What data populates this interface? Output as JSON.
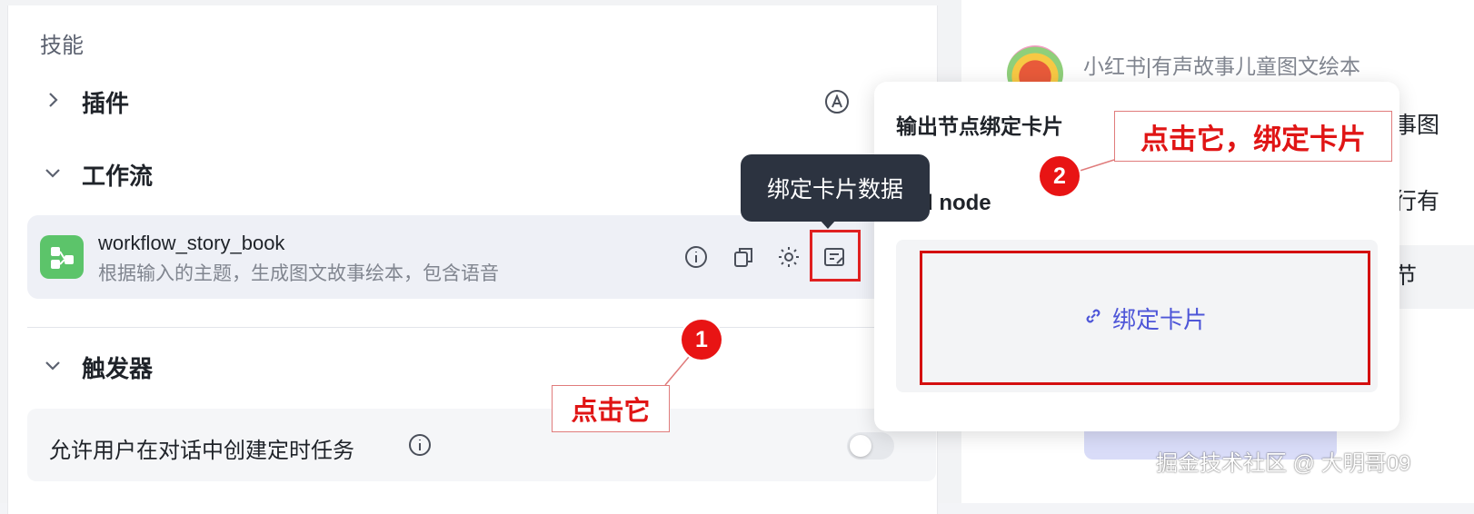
{
  "skills_panel": {
    "section_title": "技能",
    "plugins_label": "插件",
    "workflow_label": "工作流",
    "triggers_label": "触发器",
    "workflow_item": {
      "name": "workflow_story_book",
      "description": "根据输入的主题，生成图文故事绘本，包含语音"
    },
    "trigger_option_label": "允许用户在对话中创建定时任务",
    "trigger_toggle_on": false
  },
  "tooltip": {
    "text": "绑定卡片数据"
  },
  "preview": {
    "bot_title": "小红书|有声故事儿童图文绘本",
    "fragments": [
      "事图",
      "行有",
      "节"
    ]
  },
  "popover": {
    "title": "输出节点绑定卡片",
    "subtitle_fragment": "d node",
    "bind_button_label": "绑定卡片"
  },
  "annotations": {
    "step1_number": "1",
    "step1_text": "点击它",
    "step2_number": "2",
    "step2_text": "点击它，绑定卡片"
  },
  "watermark": "掘金技术社区 @ 大明哥09",
  "colors": {
    "accent": "#4e56d8",
    "annotation_red": "#e81414",
    "workflow_icon_green": "#5cc46a",
    "tooltip_bg": "#2c3340"
  }
}
